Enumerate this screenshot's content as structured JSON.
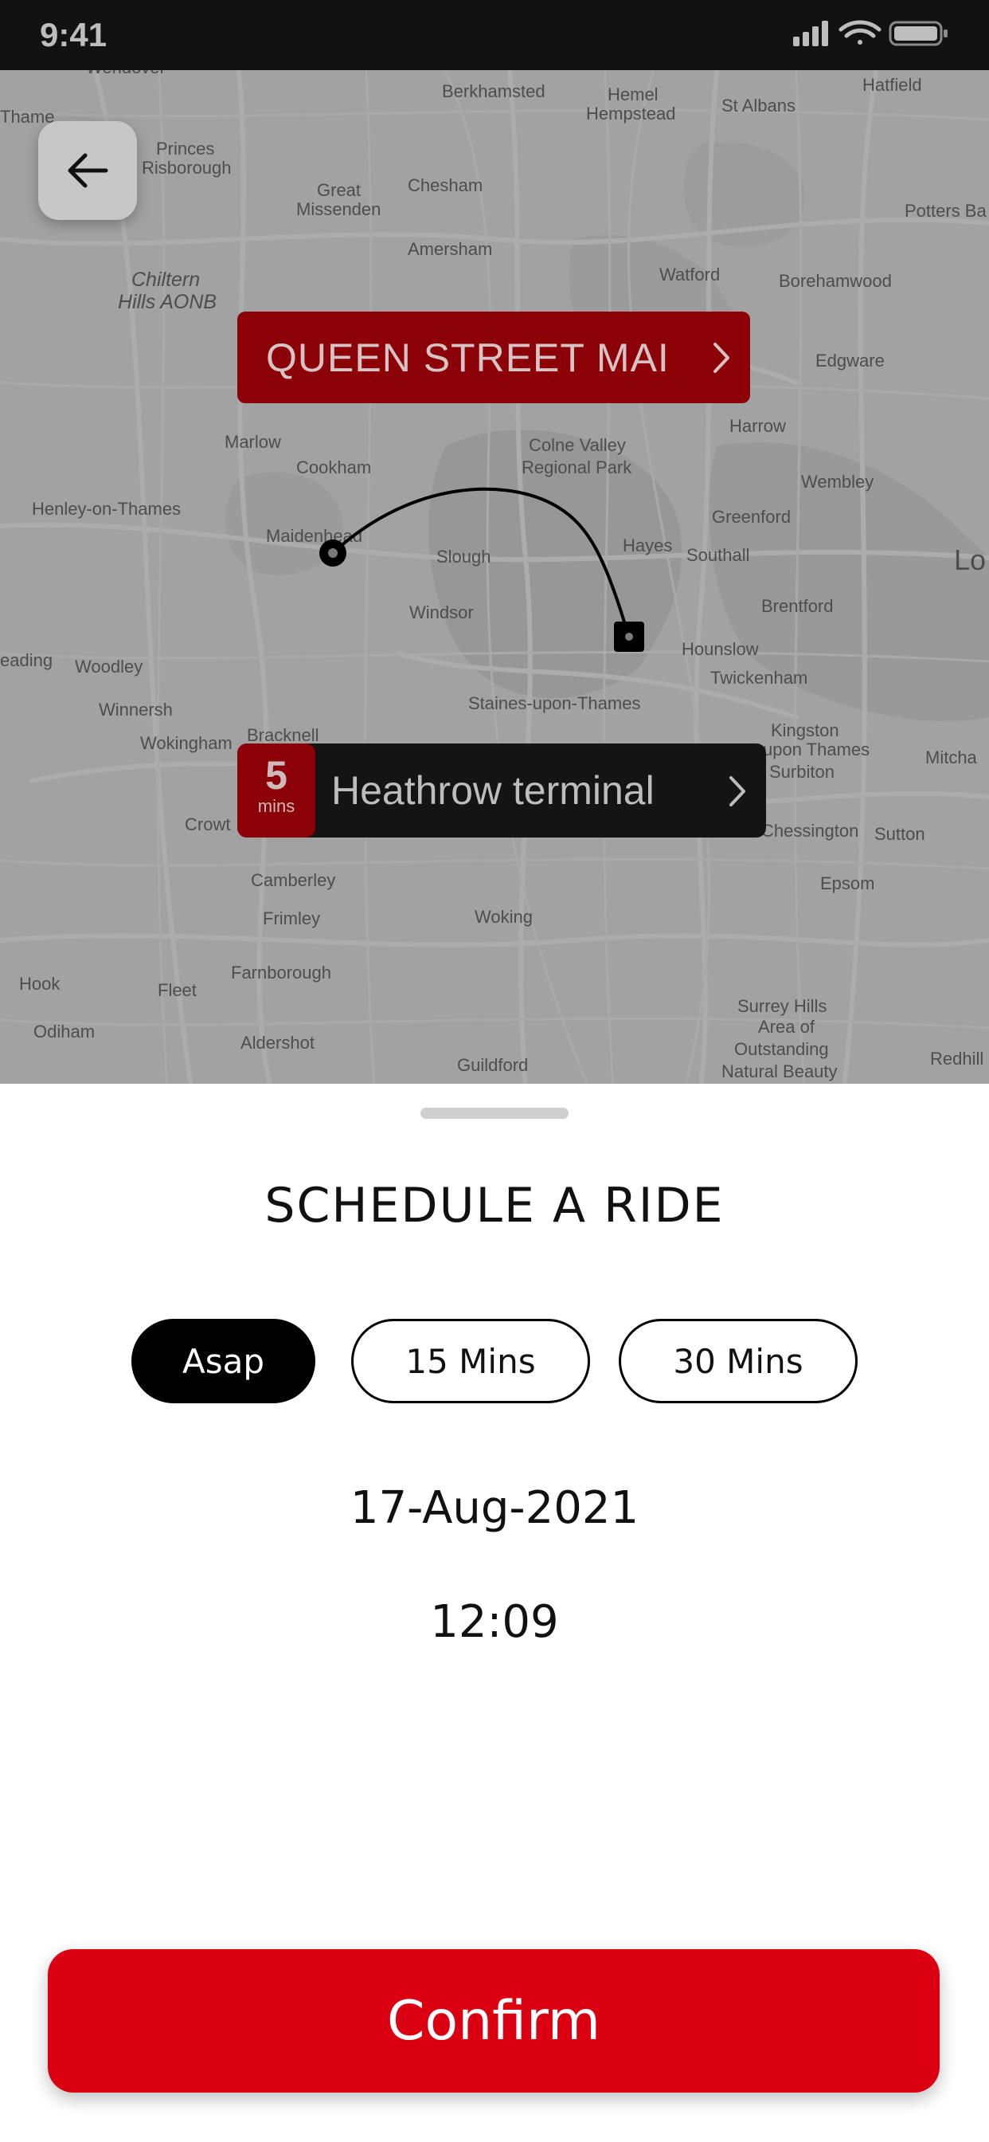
{
  "status_bar": {
    "time": "9:41"
  },
  "map": {
    "places": [
      "Wendover",
      "Berkhamsted",
      "Hemel",
      "Hempstead",
      "St Albans",
      "Hatfield",
      "Thame",
      "Princes",
      "Risborough",
      "Great",
      "Missenden",
      "Chesham",
      "Potters Ba",
      "Amersham",
      "Chiltern",
      "Hills AONB",
      "Watford",
      "Borehamwood",
      "Edgware",
      "Harrow",
      "Marlow",
      "Cookham",
      "Colne Valley",
      "Regional Park",
      "Wembley",
      "Henley-on-Thames",
      "Greenford",
      "Maidenhead",
      "Slough",
      "Hayes",
      "Southall",
      "Lo",
      "Windsor",
      "Brentford",
      "Hounslow",
      "Twickenham",
      "eading",
      "Woodley",
      "Winnersh",
      "Staines-upon-Thames",
      "Bracknell",
      "Wokingham",
      "Kingston",
      "upon Thames",
      "Surbiton",
      "Mitcha",
      "Crowt",
      "Chessington",
      "Sutton",
      "Camberley",
      "Epsom",
      "Frimley",
      "Woking",
      "Farnborough",
      "Hook",
      "Fleet",
      "Surrey Hills",
      "Area of",
      "Outstanding",
      "Natural Beauty",
      "Odiham",
      "Aldershot",
      "Guildford",
      "Redhill"
    ]
  },
  "back_button": {
    "icon": "arrow-left-icon"
  },
  "route": {
    "pickup_label": "QUEEN STREET MAI",
    "dropoff_label": "Heathrow terminal",
    "eta_value": "5",
    "eta_unit": "mins"
  },
  "sheet": {
    "title": "SCHEDULE A RIDE",
    "options": [
      {
        "label": "Asap",
        "selected": true
      },
      {
        "label": "15 Mins",
        "selected": false
      },
      {
        "label": "30 Mins",
        "selected": false
      }
    ],
    "date": "17-Aug-2021",
    "time": "12:09",
    "confirm_label": "Confirm"
  },
  "colors": {
    "brand_red": "#db0011",
    "pickup_red_dimmed": "#8c0007",
    "selected_chip": "#000000"
  }
}
